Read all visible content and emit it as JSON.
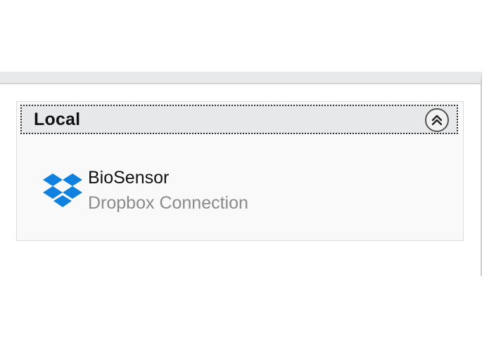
{
  "group": {
    "title": "Local",
    "collapse_icon": "double-chevron-up-icon"
  },
  "connections": [
    {
      "name": "BioSensor",
      "type": "Dropbox Connection",
      "icon": "dropbox-icon",
      "icon_color": "#1081de"
    }
  ],
  "colors": {
    "header_bg": "#e7e8e9",
    "group_bg": "#f9f9f9",
    "secondary_text": "#8a8a8a"
  }
}
